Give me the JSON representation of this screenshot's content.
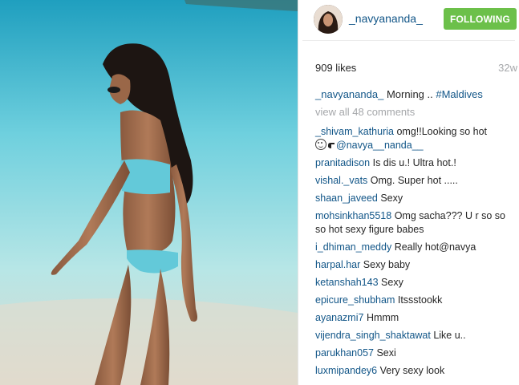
{
  "post": {
    "username": "_navyananda_",
    "follow_label": "FOLLOWING",
    "likes": "909 likes",
    "time": "32w",
    "caption": {
      "username": "_navyananda_",
      "text": "Morning ..",
      "hashtag": "#Maldives"
    },
    "view_all": "view all 48 comments"
  },
  "comments": [
    {
      "user": "_shivam_kathuria",
      "text": "omg!!Looking so hot",
      "text2": "@navya__nanda__"
    },
    {
      "user": "pranitadison",
      "text": "Is dis u.! Ultra hot.!"
    },
    {
      "user": "vishal._vats",
      "text": "Omg. Super hot ....."
    },
    {
      "user": "shaan_javeed",
      "text": "Sexy"
    },
    {
      "user": "mohsinkhan5518",
      "text": "Omg sacha??? U r so so so hot sexy figure babes"
    },
    {
      "user": "i_dhiman_meddy",
      "text": "Really hot@navya"
    },
    {
      "user": "harpal.har",
      "text": "Sexy baby"
    },
    {
      "user": "ketanshah143",
      "text": "Sexy"
    },
    {
      "user": "epicure_shubham",
      "text": "Itssstookk"
    },
    {
      "user": "ayanazmi7",
      "text": "Hmmm"
    },
    {
      "user": "vijendra_singh_shaktawat",
      "text": "Like u.."
    },
    {
      "user": "parukhan057",
      "text": "Sexi"
    },
    {
      "user": "luxmipandey6",
      "text": "Very sexy look"
    }
  ],
  "colors": {
    "username_blue": "#125688",
    "following_green": "#6cc04a",
    "muted_gray": "#a5a7aa"
  }
}
